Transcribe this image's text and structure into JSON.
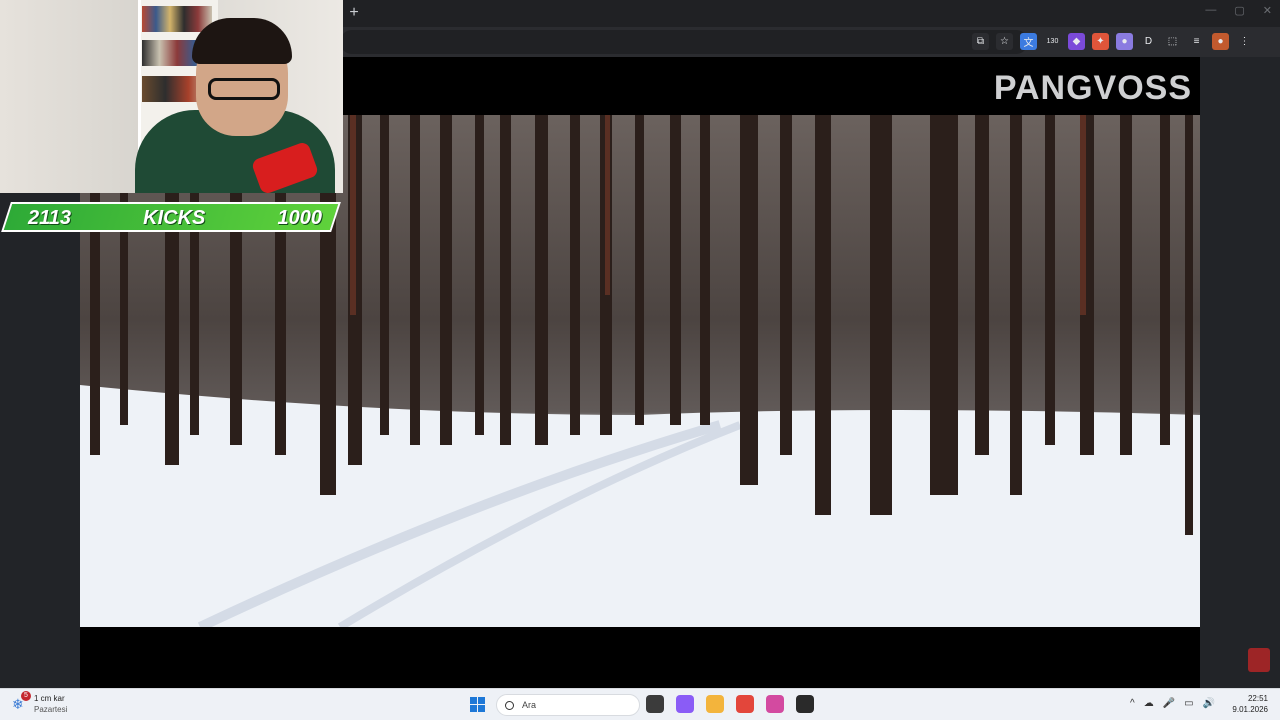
{
  "browser": {
    "new_tab_symbol": "+",
    "window_controls": [
      "—",
      "▢",
      "✕"
    ],
    "toolbar_icons": [
      {
        "name": "cast-icon",
        "glyph": "⧉",
        "color": "#2b2c30"
      },
      {
        "name": "bookmark-star-icon",
        "glyph": "☆",
        "color": "#2b2c30"
      },
      {
        "name": "translate-extension-icon",
        "glyph": "文",
        "color": "#3c7be0"
      },
      {
        "name": "counter-extension-icon",
        "glyph": "130",
        "color": "#2b2c30"
      },
      {
        "name": "shield-extension-icon",
        "glyph": "◆",
        "color": "#7b4ad9"
      },
      {
        "name": "fox-extension-icon",
        "glyph": "✦",
        "color": "#e0553a"
      },
      {
        "name": "cloud-extension-icon",
        "glyph": "●",
        "color": "#8a7be0"
      },
      {
        "name": "d-extension-icon",
        "glyph": "D",
        "color": "#2b2c30"
      },
      {
        "name": "puzzle-extensions-icon",
        "glyph": "⬚",
        "color": "#2b2c30"
      },
      {
        "name": "reading-list-icon",
        "glyph": "≡",
        "color": "#2b2c30"
      },
      {
        "name": "profile-avatar-icon",
        "glyph": "●",
        "color": "#c25a2e"
      },
      {
        "name": "menu-dots-icon",
        "glyph": "⋮",
        "color": "#2b2c30"
      }
    ]
  },
  "video": {
    "channel_logo": "PANGVOSS"
  },
  "overlay": {
    "score_left": "2113",
    "score_label": "KICKS",
    "score_right": "1000"
  },
  "taskbar": {
    "weather_temp": "1 cm kar",
    "weather_day": "Pazartesi",
    "weather_badge": "5",
    "search_placeholder": "Ara",
    "tray_icons": [
      "^",
      "☁",
      "🎤",
      "▭",
      "🔊"
    ],
    "time": "22:51",
    "date": "9.01.2026",
    "apps": [
      {
        "name": "task-view-icon",
        "color": "#3b3b3b"
      },
      {
        "name": "copilot-icon",
        "color": "#8a5cf6"
      },
      {
        "name": "file-explorer-icon",
        "color": "#f3b43c"
      },
      {
        "name": "chrome-icon",
        "color": "#e3463b"
      },
      {
        "name": "snipping-tool-icon",
        "color": "#d34aa0"
      },
      {
        "name": "obs-icon",
        "color": "#2a2a2a"
      }
    ]
  }
}
